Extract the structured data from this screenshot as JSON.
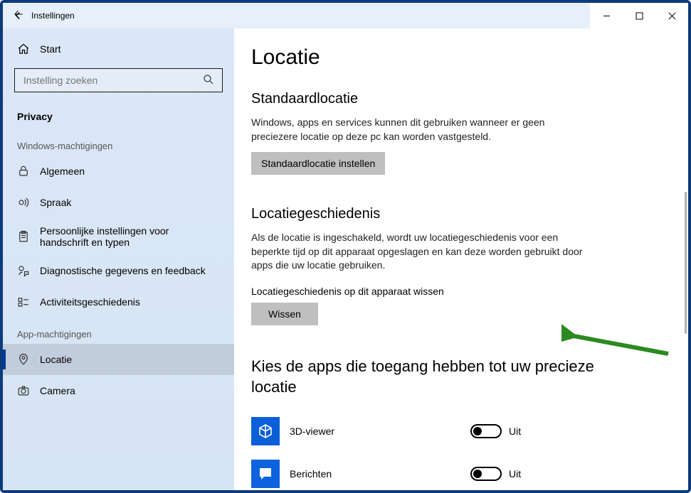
{
  "window": {
    "title": "Instellingen"
  },
  "sidebar": {
    "home_label": "Start",
    "search_placeholder": "Instelling zoeken",
    "category": "Privacy",
    "group_windows": "Windows-machtigingen",
    "group_apps": "App-machtigingen",
    "items": {
      "algemeen": "Algemeen",
      "spraak": "Spraak",
      "handschrift": "Persoonlijke instellingen voor handschrift en typen",
      "diagnostiek": "Diagnostische gegevens en feedback",
      "activiteit": "Activiteitsgeschiedenis",
      "locatie": "Locatie",
      "camera": "Camera"
    }
  },
  "page": {
    "title": "Locatie",
    "default_location": {
      "heading": "Standaardlocatie",
      "desc": "Windows, apps en services kunnen dit gebruiken wanneer er geen preciezere locatie op deze pc kan worden vastgesteld.",
      "button": "Standaardlocatie instellen"
    },
    "history": {
      "heading": "Locatiegeschiedenis",
      "desc": "Als de locatie is ingeschakeld, wordt uw locatiegeschiedenis voor een beperkte tijd op dit apparaat opgeslagen en kan deze worden gebruikt door apps die uw locatie gebruiken.",
      "sub": "Locatiegeschiedenis op dit apparaat wissen",
      "button": "Wissen"
    },
    "apps_section": {
      "heading": "Kies de apps die toegang hebben tot uw precieze locatie",
      "off_label": "Uit",
      "apps": {
        "viewer3d": "3D-viewer",
        "berichten": "Berichten"
      }
    }
  }
}
